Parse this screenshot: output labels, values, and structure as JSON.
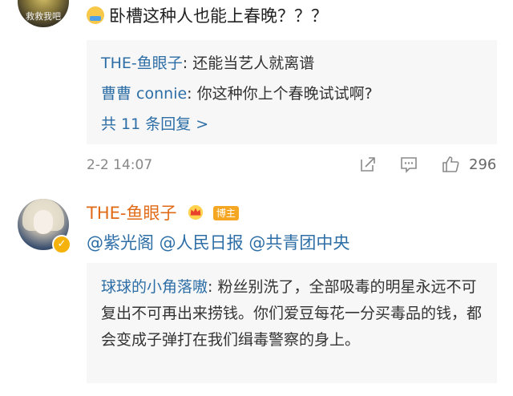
{
  "comment1": {
    "avatar_text": "救救我吧",
    "text": "卧槽这种人也能上春晚？？？",
    "replies": [
      {
        "user": "THE-鱼眼子",
        "text": ": 还能当艺人就离谱"
      },
      {
        "user": "曹曹 connie",
        "text": ": 你这种你上个春晚试试啊?"
      }
    ],
    "more_replies": "共 11 条回复 >",
    "timestamp": "2-2 14:07",
    "likes": "296",
    "icons": [
      "share-icon",
      "comment-icon",
      "like-icon",
      "emoji-icon"
    ]
  },
  "comment2": {
    "user": "THE-鱼眼子",
    "badge": "博主",
    "mentions": "@紫光阁 @人民日报 @共青团中央",
    "reply": {
      "user": "球球的小角落嗷",
      "text": ": 粉丝别洗了，全部吸毒的明星永远不可复出不可再出来捞钱。你们爱豆每花一分买毒品的钱，都会变成子弹打在我们缉毒警察的身上。"
    },
    "icons": [
      "crown-icon",
      "verified-icon"
    ]
  },
  "colors": {
    "username": "#2d6ea6",
    "author_name": "#e06a16",
    "reply_bg": "#f7f7f7",
    "badge": "#f5a623"
  }
}
